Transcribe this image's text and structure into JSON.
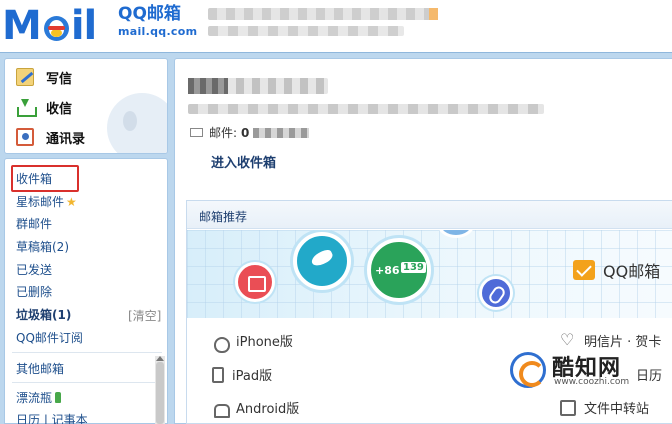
{
  "header": {
    "logo_m": "M",
    "logo_il": "il",
    "logo_title": "QQ邮箱",
    "logo_domain": "mail.qq.com"
  },
  "sidebar": {
    "actions": [
      {
        "label": "写信",
        "icon": "compose-icon"
      },
      {
        "label": "收信",
        "icon": "receive-icon"
      },
      {
        "label": "通讯录",
        "icon": "contacts-icon"
      }
    ],
    "folders": {
      "inbox": "收件箱",
      "starred": "星标邮件",
      "group": "群邮件",
      "drafts": "草稿箱(2)",
      "sent": "已发送",
      "deleted": "已删除",
      "spam": "垃圾箱(1)",
      "spam_clear": "[清空]",
      "subscriptions": "QQ邮件订阅",
      "other_mailboxes": "其他邮箱",
      "drift_bottle": "漂流瓶",
      "calendar_notes": "日历 | 记事本"
    },
    "highlight_color": "#d9302c"
  },
  "main": {
    "mail_count_label": "邮件:",
    "mail_count_value": "0",
    "enter_inbox": "进入收件箱",
    "recommend": {
      "title": "邮箱推荐",
      "banner_tag": "QQ邮箱",
      "banner_phone_prefix": "+86",
      "banner_phone_number": "139",
      "clients": [
        {
          "label": "iPhone版",
          "icon": "apple-icon"
        },
        {
          "label": "iPad版",
          "icon": "ipad-icon"
        },
        {
          "label": "Android版",
          "icon": "android-icon"
        }
      ],
      "right_items": [
        {
          "label": "明信片 · 贺卡",
          "icon": "heart-icon"
        },
        {
          "label": "日历",
          "icon": "calendar-icon"
        },
        {
          "label": "文件中转站",
          "icon": "file-transfer-icon"
        }
      ]
    }
  },
  "watermark": {
    "name": "酷知网",
    "url": "www.coozhi.com"
  },
  "colors": {
    "brand_blue": "#1f6bd0",
    "frame_blue": "#bcd7ee",
    "link_blue": "#1e4f8c"
  }
}
